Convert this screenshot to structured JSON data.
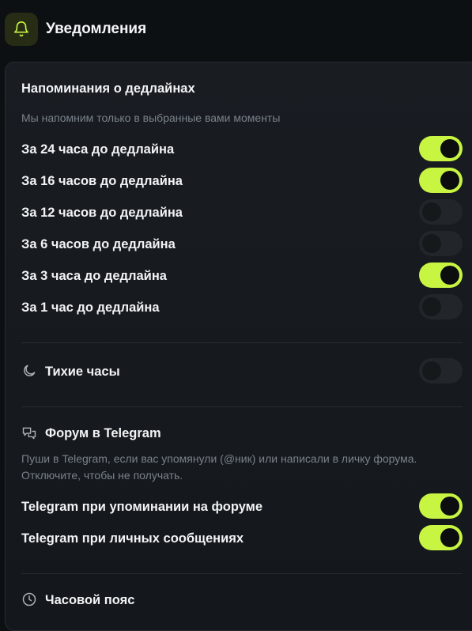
{
  "header": {
    "title": "Уведомления",
    "icon": "bell-icon",
    "accent": "#c8f542"
  },
  "deadlines": {
    "title": "Напоминания о дедлайнах",
    "subtitle": "Мы напомним только в выбранные вами моменты",
    "items": [
      {
        "label": "За 24 часа до дедлайна",
        "enabled": true
      },
      {
        "label": "За 16 часов до дедлайна",
        "enabled": true
      },
      {
        "label": "За 12 часов до дедлайна",
        "enabled": false
      },
      {
        "label": "За 6 часов до дедлайна",
        "enabled": false
      },
      {
        "label": "За 3 часа до дедлайна",
        "enabled": true
      },
      {
        "label": "За 1 час до дедлайна",
        "enabled": false
      }
    ]
  },
  "quiet_hours": {
    "label": "Тихие часы",
    "icon": "moon-icon",
    "enabled": false
  },
  "forum": {
    "title": "Форум в Telegram",
    "icon": "chat-bubbles-icon",
    "description": "Пуши в Telegram, если вас упомянули (@ник) или написали в личку форума. Отключите, чтобы не получать.",
    "items": [
      {
        "label": "Telegram при упоминании на форуме",
        "enabled": true
      },
      {
        "label": "Telegram при личных сообщениях",
        "enabled": true
      }
    ]
  },
  "timezone": {
    "title": "Часовой пояс",
    "icon": "clock-icon"
  }
}
